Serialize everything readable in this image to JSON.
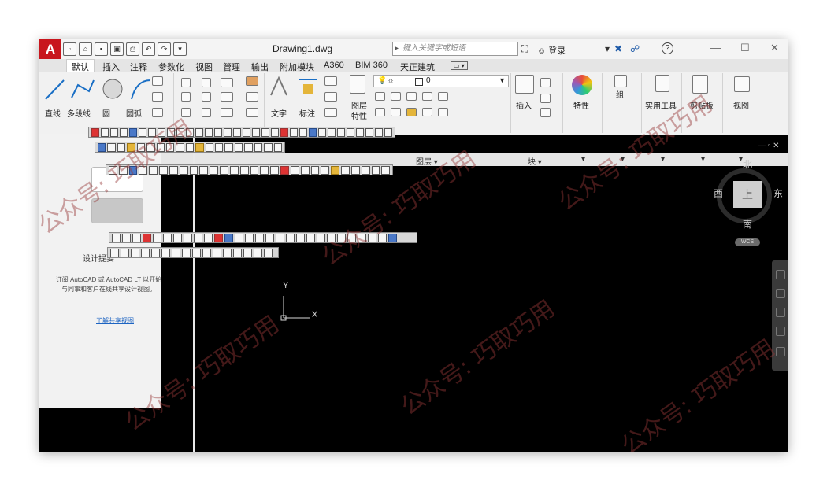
{
  "title_bar": {
    "document": "Drawing1.dwg",
    "search_placeholder": "键入关键字或短语",
    "login": "登录",
    "help": "?",
    "minimize": "—",
    "maximize": "☐",
    "close": "✕"
  },
  "tabs": [
    "默认",
    "插入",
    "注释",
    "参数化",
    "视图",
    "管理",
    "输出",
    "附加模块",
    "A360",
    "BIM 360",
    "天正建筑"
  ],
  "ribbon": {
    "draw": [
      "直线",
      "多段线",
      "圆",
      "圆弧"
    ],
    "text": "文字",
    "dim": "标注",
    "layer_props": [
      "图层",
      "特性"
    ],
    "layer_value": "0",
    "insert": "插入",
    "properties": "特性",
    "group": "组",
    "utilities": "实用工具",
    "clipboard": "剪贴板",
    "view": "视图"
  },
  "panel_labels": {
    "layers": "图层 ▾",
    "block": "块 ▾"
  },
  "palette": {
    "title": "设计提要",
    "text": "订阅 AutoCAD 或 AutoCAD LT 以开始与同事和客户在线共享设计视图。",
    "link": "了解共享视图"
  },
  "viewcube": {
    "north": "北",
    "south": "南",
    "east": "东",
    "west": "西",
    "top": "上",
    "wcs": "WCS"
  },
  "ucs": {
    "x": "X",
    "y": "Y"
  },
  "watermark": "公众号: 巧取巧用",
  "colors": {
    "app_red": "#c8161d",
    "canvas": "#000000",
    "link": "#1d64c2"
  }
}
